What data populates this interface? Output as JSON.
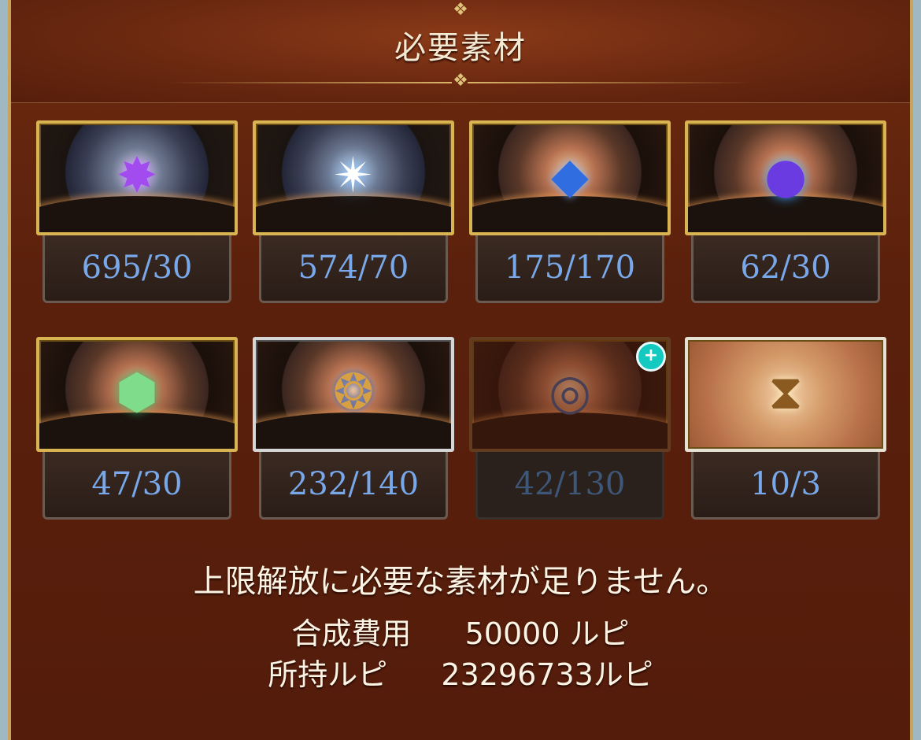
{
  "title": "必要素材",
  "materials": [
    {
      "count": "695/30",
      "icon": "purple-crystal-icon"
    },
    {
      "count": "574/70",
      "icon": "light-orb-icon"
    },
    {
      "count": "175/170",
      "icon": "blue-crystal-icon"
    },
    {
      "count": "62/30",
      "icon": "cosmic-sphere-icon"
    },
    {
      "count": "47/30",
      "icon": "green-hex-icon"
    },
    {
      "count": "232/140",
      "icon": "ornate-emblem-icon"
    },
    {
      "count": "42/130",
      "icon": "astral-disc-icon"
    },
    {
      "count": "10/3",
      "icon": "hourglass-icon"
    }
  ],
  "message": "上限解放に必要な素材が足りません。",
  "cost": {
    "label": "合成費用",
    "value": "50000 ルピ"
  },
  "owned": {
    "label": "所持ルピ",
    "value": "23296733ルピ"
  }
}
